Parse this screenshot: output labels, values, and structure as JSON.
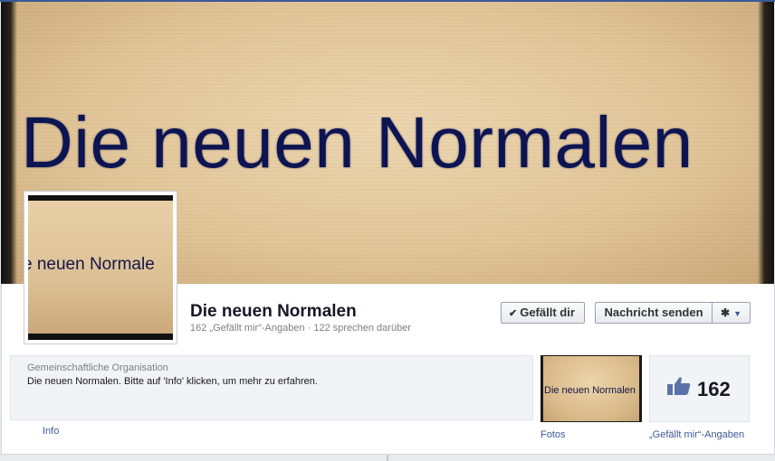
{
  "cover": {
    "text": "Die neuen Normalen"
  },
  "profile": {
    "picture_text": "e neuen Normale"
  },
  "page": {
    "name": "Die neuen Normalen",
    "stats": "162 „Gefällt mir“-Angaben · 122 sprechen darüber"
  },
  "actions": {
    "like_label": "Gefällt dir",
    "message_label": "Nachricht senden",
    "gear_icon": "gear-icon",
    "caret_icon": "caret-down-icon"
  },
  "about": {
    "category": "Gemeinschaftliche Organisation",
    "description": "Die neuen Normalen. Bitte auf 'Info' klicken, um mehr zu erfahren."
  },
  "tabs": {
    "info": "Info",
    "photos": "Fotos",
    "photos_thumb_text": "Die neuen Normalen",
    "likes_count": "162",
    "likes_label": "„Gefällt mir“-Angaben"
  },
  "colors": {
    "brand_blue": "#3b5998",
    "cover_text": "#0d1452"
  }
}
